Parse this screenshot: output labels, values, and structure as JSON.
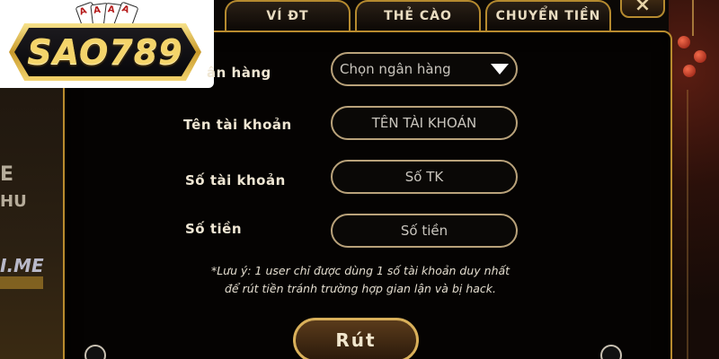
{
  "brand": {
    "logo_text": "SAO789",
    "card_ranks": [
      "A",
      "A",
      "A",
      "A"
    ]
  },
  "background": {
    "left_fragments": [
      "E",
      "HU",
      "I.ME"
    ]
  },
  "tabs": [
    {
      "label": "VÍ ĐT"
    },
    {
      "label": "THẺ CÀO"
    },
    {
      "label": "CHUYỂN TIỀN"
    }
  ],
  "close_label": "×",
  "form": {
    "bank_label": "Ngân hàng",
    "bank_label_visible": "ân hàng",
    "bank_select_value": "Chọn ngân hàng",
    "account_name_label": "Tên tài khoản",
    "account_name_placeholder": "TÊN TÀI KHOẢN",
    "account_number_label": "Số tài khoản",
    "account_number_placeholder": "Số TK",
    "amount_label": "Số tiền",
    "amount_placeholder": "Số tiền"
  },
  "note": {
    "line1": "*Lưu ý: 1 user chỉ được dùng 1 số tài khoản duy nhất",
    "line2": "để rút tiền tránh trường hợp gian lận và bị hack."
  },
  "submit_label": "Rút",
  "colors": {
    "gold": "#b88b2e",
    "panel_bg": "#050302",
    "text": "#efe6d3"
  }
}
